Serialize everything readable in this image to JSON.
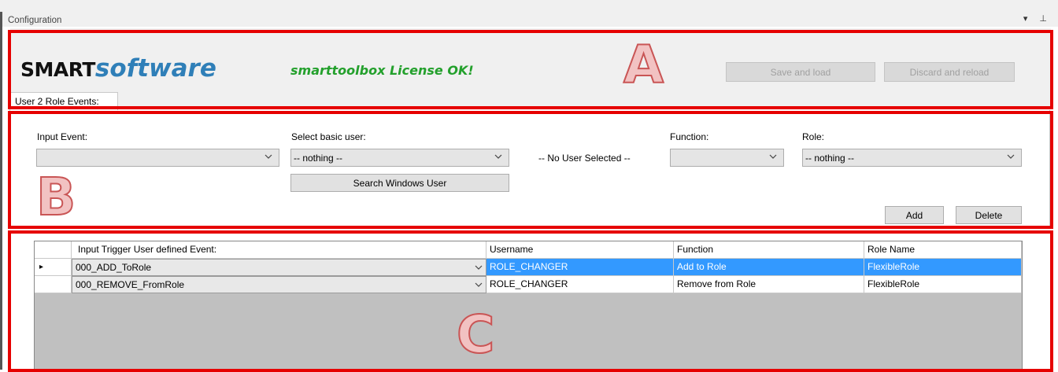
{
  "window": {
    "title": "Configuration",
    "controls": "▾ ⊥"
  },
  "header": {
    "logo_bold": "SMART",
    "logo_italic": "software",
    "license_status": "smarttoolbox License OK!",
    "save_button": "Save and load",
    "discard_button": "Discard and reload"
  },
  "tabs": [
    "User 2 Role Events:"
  ],
  "form": {
    "input_event_label": "Input Event:",
    "input_event_value": "",
    "basic_user_label": "Select basic user:",
    "basic_user_value": "-- nothing --",
    "no_user_text": "-- No User Selected --",
    "function_label": "Function:",
    "function_value": "",
    "role_label": "Role:",
    "role_value": "-- nothing --",
    "search_button": "Search Windows User",
    "add_button": "Add",
    "delete_button": "Delete"
  },
  "grid": {
    "columns": [
      "Input Trigger User defined Event:",
      "Username",
      "Function",
      "Role Name"
    ],
    "rows": [
      {
        "event": "000_ADD_ToRole",
        "username": "ROLE_CHANGER",
        "function": "Add to Role",
        "role": "FlexibleRole",
        "selected": true,
        "marker": "▸"
      },
      {
        "event": "000_REMOVE_FromRole",
        "username": "ROLE_CHANGER",
        "function": "Remove from Role",
        "role": "FlexibleRole",
        "selected": false,
        "marker": ""
      }
    ]
  },
  "annotations": {
    "a": "A",
    "b": "B",
    "c": "C"
  },
  "colors": {
    "annotation_red": "#e60000",
    "selection_blue": "#3399ff",
    "license_green": "#23a02c",
    "logo_blue": "#2f7fb8"
  },
  "icons": [
    "chevron-down-icon",
    "row-pointer-icon",
    "pin-icon"
  ]
}
